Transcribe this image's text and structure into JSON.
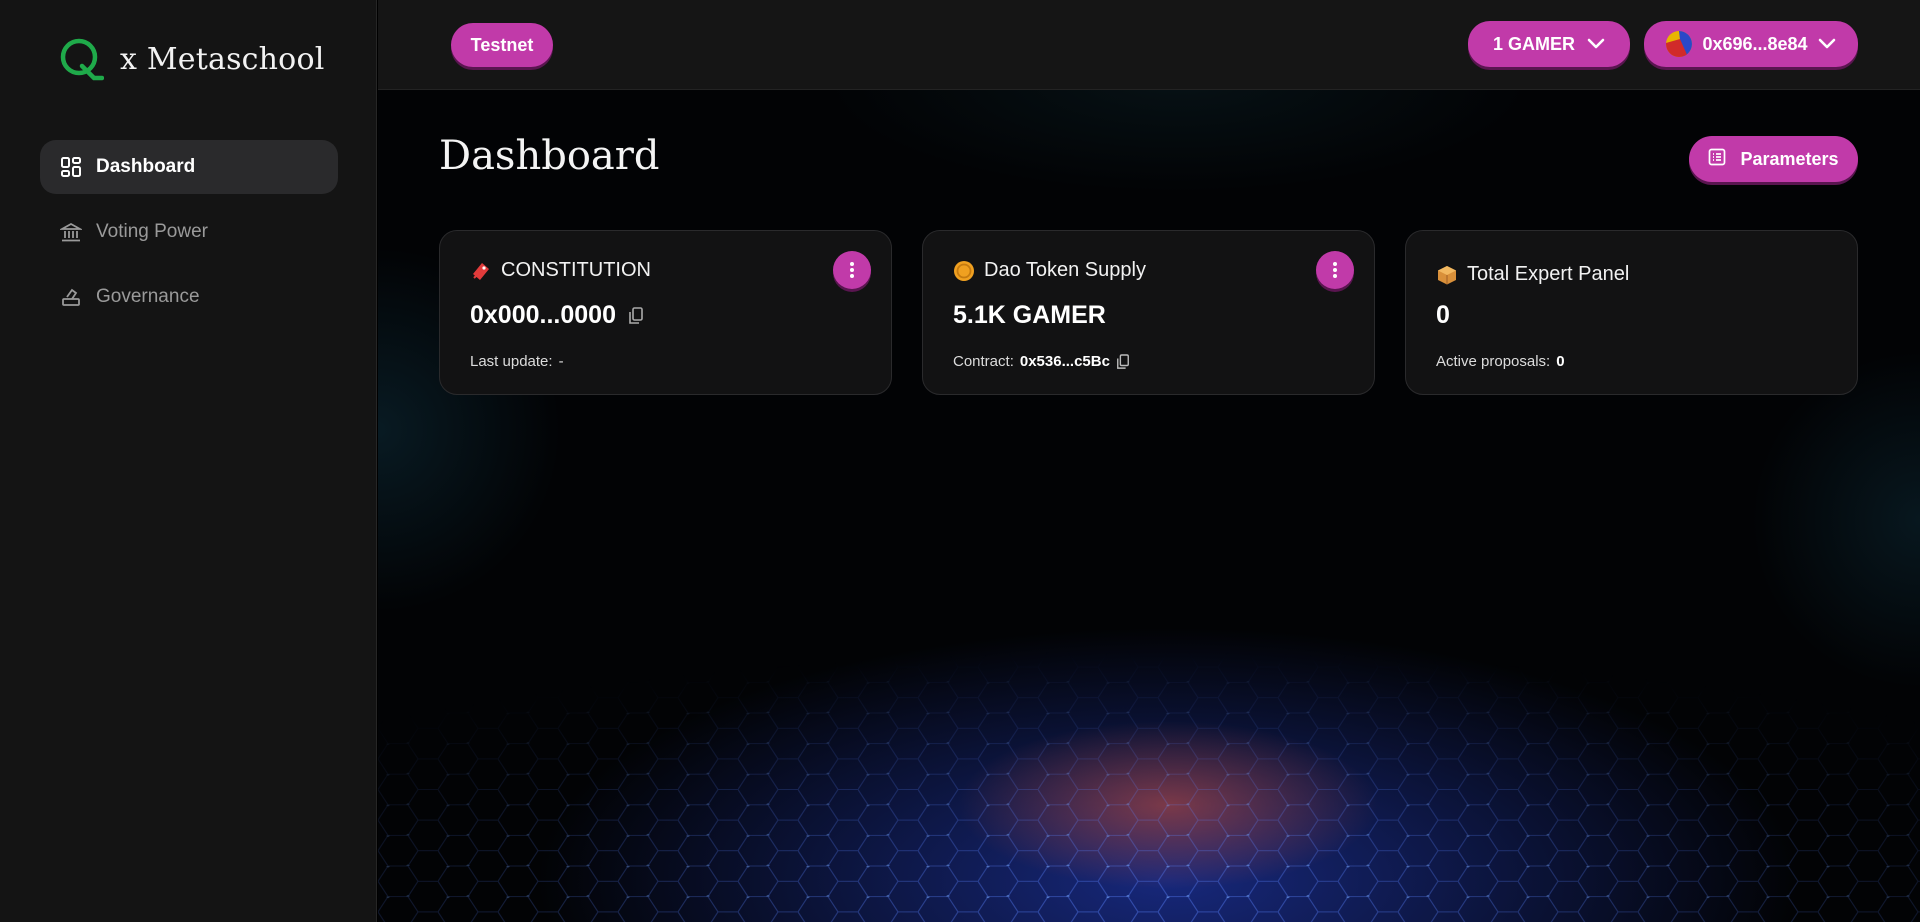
{
  "brand": {
    "name": "x Metaschool",
    "logo_letter": "Q"
  },
  "sidebar": {
    "items": [
      {
        "label": "Dashboard",
        "icon": "dashboard-icon",
        "active": true
      },
      {
        "label": "Voting Power",
        "icon": "bank-icon",
        "active": false
      },
      {
        "label": "Governance",
        "icon": "vote-icon",
        "active": false
      }
    ]
  },
  "topbar": {
    "network_label": "Testnet",
    "balance_label": "1 GAMER",
    "wallet_address": "0x696...8e84"
  },
  "main": {
    "title": "Dashboard",
    "parameters_label": "Parameters",
    "cards": [
      {
        "title": "CONSTITUTION",
        "icon": "ticket-icon",
        "value": "0x000...0000",
        "foot_label": "Last update:",
        "foot_value": "-"
      },
      {
        "title": "Dao Token Supply",
        "icon": "coin-icon",
        "value": "5.1K GAMER",
        "foot_label": "Contract:",
        "foot_value": "0x536...c5Bc"
      },
      {
        "title": "Total Expert Panel",
        "icon": "package-icon",
        "value": "0",
        "foot_label": "Active proposals:",
        "foot_value": "0"
      }
    ]
  },
  "colors": {
    "accent": "#c13aa9",
    "sidebar_bg": "#141414",
    "card_bg": "#121213",
    "logo_green": "#1faa4a"
  }
}
